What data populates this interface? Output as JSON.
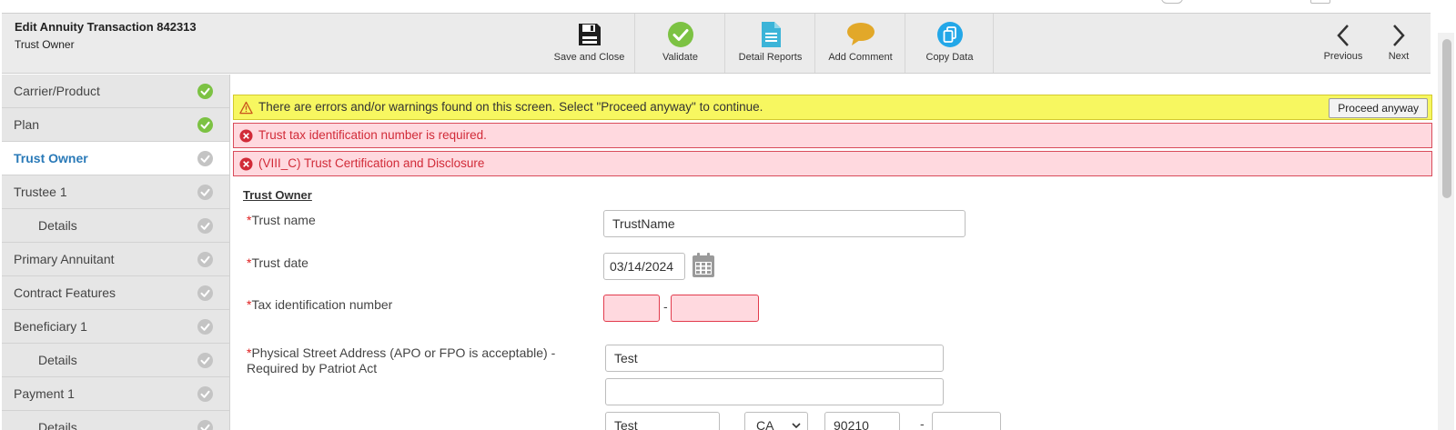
{
  "header": {
    "title": "Edit Annuity Transaction 842313",
    "subtitle": "Trust Owner"
  },
  "toolbar": {
    "save_close": "Save and Close",
    "validate": "Validate",
    "detail_reports": "Detail Reports",
    "add_comment": "Add Comment",
    "copy_data": "Copy Data",
    "previous": "Previous",
    "next": "Next"
  },
  "sidebar": {
    "items": [
      {
        "label": "Carrier/Product",
        "status": "complete"
      },
      {
        "label": "Plan",
        "status": "complete"
      },
      {
        "label": "Trust Owner",
        "status": "active"
      },
      {
        "label": "Trustee 1",
        "status": "pending"
      },
      {
        "label": "Details",
        "status": "pending"
      },
      {
        "label": "Primary Annuitant",
        "status": "pending"
      },
      {
        "label": "Contract Features",
        "status": "pending"
      },
      {
        "label": "Beneficiary 1",
        "status": "pending"
      },
      {
        "label": "Details",
        "status": "pending"
      },
      {
        "label": "Payment 1",
        "status": "pending"
      },
      {
        "label": "Details",
        "status": "pending"
      }
    ]
  },
  "banners": {
    "warning": "There are errors and/or warnings found on this screen. Select \"Proceed anyway\" to continue.",
    "proceed_label": "Proceed anyway",
    "error1": "Trust tax identification number is required.",
    "error2": "(VIII_C) Trust Certification and Disclosure"
  },
  "form": {
    "section_title": "Trust Owner",
    "required_mark": "*",
    "trust_name_label": "Trust name",
    "trust_name_value": "TrustName",
    "trust_date_label": "Trust date",
    "trust_date_value": "03/14/2024",
    "tin_label": "Tax identification number",
    "tin_part1": "",
    "tin_part2": "",
    "tin_separator": "-",
    "address_label": "Physical Street Address (APO or FPO is acceptable) - Required by Patriot Act",
    "address_line1": "Test",
    "address_line2": "",
    "city": "Test",
    "state": "CA",
    "zip": "90210",
    "zip_separator": "-",
    "zip_ext": ""
  },
  "colors": {
    "complete": "#7cc243",
    "pending": "#c4c4c4",
    "accent": "#2a7ab8",
    "warning_bg": "#f7f760",
    "error_bg": "#ffd9df",
    "error_text": "#d12b38"
  }
}
